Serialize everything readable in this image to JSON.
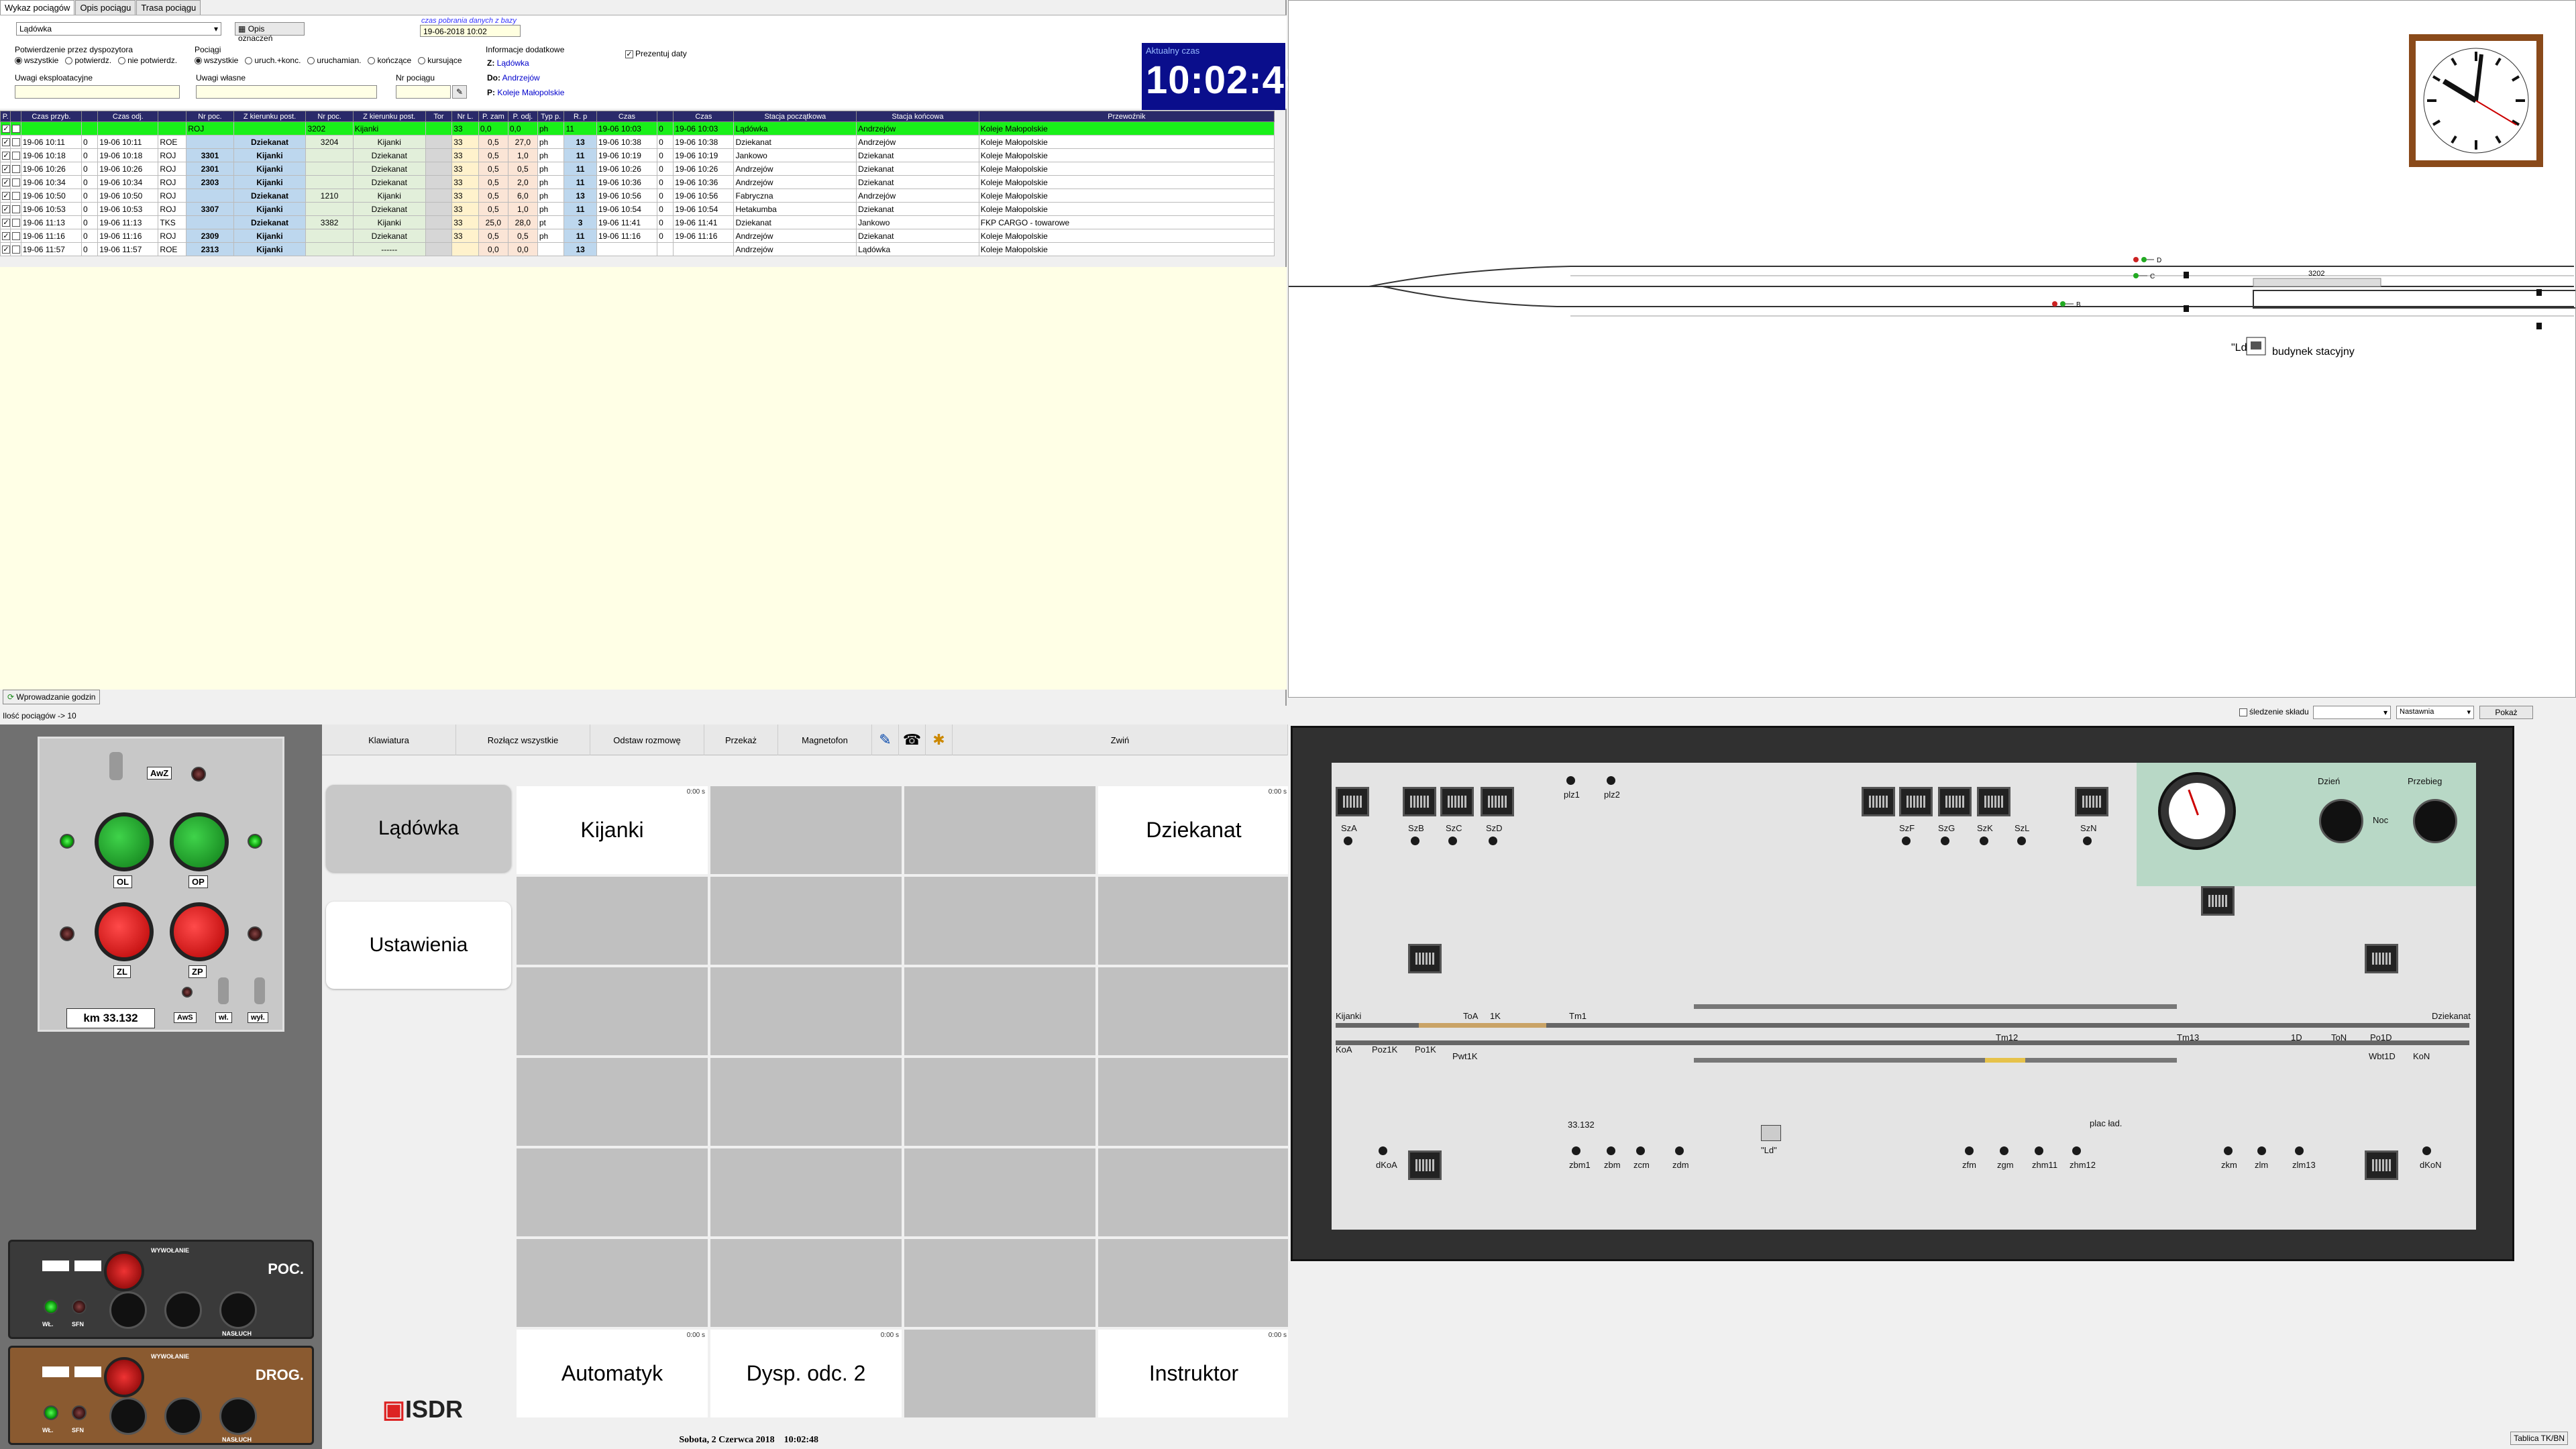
{
  "tabs": [
    "Wykaz pociągów",
    "Opis pociągu",
    "Trasa pociągu"
  ],
  "station_select": "Lądówka",
  "opis_button": "Opis oznaczeń",
  "db_time_label": "czas pobrania danych z bazy",
  "db_time_value": "19-06-2018 10:02",
  "filters": {
    "confirm_label": "Potwierdzenie przez dyspozytora",
    "confirm_opts": [
      "wszystkie",
      "potwierdz.",
      "nie potwierdz."
    ],
    "trains_label": "Pociągi",
    "trains_opts": [
      "wszystkie",
      "uruch.+konc.",
      "uruchamian.",
      "kończące",
      "kursujące"
    ],
    "info_label": "Informacje dodatkowe",
    "z_label": "Z:",
    "z_val": "Lądówka",
    "do_label": "Do:",
    "do_val": "Andrzejów",
    "p_label": "P:",
    "p_val": "Koleje Małopolskie",
    "uwagi_ekspl": "Uwagi eksploatacyjne",
    "uwagi_wlasne": "Uwagi własne",
    "nr_pociagu": "Nr pociągu",
    "prezentuj": "Prezentuj daty"
  },
  "current_time_label": "Aktualny czas",
  "current_time": "10:02:48",
  "table": {
    "headers": [
      "P.",
      "",
      "Czas przyb.",
      "",
      "Czas odj.",
      "",
      "Nr poc.",
      "Z kierunku post.",
      "Nr poc.",
      "Z kierunku post.",
      "Tor",
      "Nr L.",
      "P. zam",
      "P. odj.",
      "Typ p.",
      "R. p",
      "Czas",
      "",
      "Czas",
      "Stacja początkowa",
      "Stacja końcowa",
      "Przewoźnik"
    ],
    "rows": [
      [
        "",
        "",
        "",
        "",
        "ROJ",
        "",
        "3202",
        "Kijanki",
        "",
        "33",
        "0,0",
        "0,0",
        "ph",
        "11",
        "19-06 10:03",
        "0",
        "19-06 10:03",
        "Lądówka",
        "Andrzejów",
        "Koleje Małopolskie"
      ],
      [
        "19-06 10:11",
        "0",
        "19-06 10:11",
        "ROE",
        "",
        "Dziekanat",
        "3204",
        "Kijanki",
        "",
        "33",
        "0,5",
        "27,0",
        "ph",
        "13",
        "19-06 10:38",
        "0",
        "19-06 10:38",
        "Dziekanat",
        "Andrzejów",
        "Koleje Małopolskie"
      ],
      [
        "19-06 10:18",
        "0",
        "19-06 10:18",
        "ROJ",
        "3301",
        "Kijanki",
        "",
        "Dziekanat",
        "",
        "33",
        "0,5",
        "1,0",
        "ph",
        "11",
        "19-06 10:19",
        "0",
        "19-06 10:19",
        "Jankowo",
        "Dziekanat",
        "Koleje Małopolskie"
      ],
      [
        "19-06 10:26",
        "0",
        "19-06 10:26",
        "ROJ",
        "2301",
        "Kijanki",
        "",
        "Dziekanat",
        "",
        "33",
        "0,5",
        "0,5",
        "ph",
        "11",
        "19-06 10:26",
        "0",
        "19-06 10:26",
        "Andrzejów",
        "Dziekanat",
        "Koleje Małopolskie"
      ],
      [
        "19-06 10:34",
        "0",
        "19-06 10:34",
        "ROJ",
        "2303",
        "Kijanki",
        "",
        "Dziekanat",
        "",
        "33",
        "0,5",
        "2,0",
        "ph",
        "11",
        "19-06 10:36",
        "0",
        "19-06 10:36",
        "Andrzejów",
        "Dziekanat",
        "Koleje Małopolskie"
      ],
      [
        "19-06 10:50",
        "0",
        "19-06 10:50",
        "ROJ",
        "",
        "Dziekanat",
        "1210",
        "Kijanki",
        "",
        "33",
        "0,5",
        "6,0",
        "ph",
        "13",
        "19-06 10:56",
        "0",
        "19-06 10:56",
        "Fabryczna",
        "Andrzejów",
        "Koleje Małopolskie"
      ],
      [
        "19-06 10:53",
        "0",
        "19-06 10:53",
        "ROJ",
        "3307",
        "Kijanki",
        "",
        "Dziekanat",
        "",
        "33",
        "0,5",
        "1,0",
        "ph",
        "11",
        "19-06 10:54",
        "0",
        "19-06 10:54",
        "Hetakumba",
        "Dziekanat",
        "Koleje Małopolskie"
      ],
      [
        "19-06 11:13",
        "0",
        "19-06 11:13",
        "TKS",
        "",
        "Dziekanat",
        "3382",
        "Kijanki",
        "",
        "33",
        "25,0",
        "28,0",
        "pt",
        "3",
        "19-06 11:41",
        "0",
        "19-06 11:41",
        "Dziekanat",
        "Jankowo",
        "FKP CARGO - towarowe"
      ],
      [
        "19-06 11:16",
        "0",
        "19-06 11:16",
        "ROJ",
        "2309",
        "Kijanki",
        "",
        "Dziekanat",
        "",
        "33",
        "0,5",
        "0,5",
        "ph",
        "11",
        "19-06 11:16",
        "0",
        "19-06 11:16",
        "Andrzejów",
        "Dziekanat",
        "Koleje Małopolskie"
      ],
      [
        "19-06 11:57",
        "0",
        "19-06 11:57",
        "ROE",
        "2313",
        "Kijanki",
        "",
        "------",
        "",
        "",
        "0,0",
        "0,0",
        "",
        "13",
        "",
        "",
        "",
        "Andrzejów",
        "Lądówka",
        "Koleje Małopolskie"
      ]
    ]
  },
  "wprowadzanie": "Wprowadzanie godzin",
  "status_count": "Ilość pociągów -> 10",
  "schema": {
    "track_3202": "3202",
    "ld_label": "\"Ld\"",
    "building": "budynek stacyjny",
    "sig_d": "D",
    "sig_c": "C",
    "sig_b": "B"
  },
  "right_top_bar": {
    "sledzenie": "śledzenie składu",
    "nastawnia": "Nastawnia",
    "pokaz": "Pokaż"
  },
  "console": {
    "awz": "AwZ",
    "ol": "OL",
    "op": "OP",
    "zl": "ZL",
    "zp": "ZP",
    "km": "km 33.132",
    "aws": "AwS",
    "wl": "wł.",
    "wyl": "wył.",
    "poc": "POC.",
    "drog": "DROG.",
    "wywolanie": "WYWOŁANIE",
    "nasluch": "NASŁUCH",
    "wl_short": "WŁ.",
    "sfn": "SFN"
  },
  "toolbar": [
    "Klawiatura",
    "Rozłącz wszystkie",
    "Odstaw rozmowę",
    "Przekaż",
    "Magnetofon",
    "Zwiń"
  ],
  "dispatcher": {
    "side": [
      "Lądówka",
      "Ustawienia"
    ],
    "cells": {
      "kijanki": "Kijanki",
      "dziekanat": "Dziekanat",
      "automatyk": "Automatyk",
      "dysp": "Dysp. odc. 2",
      "instruktor": "Instruktor",
      "timer": "0:00 s"
    },
    "brand": "ISDR",
    "status_date": "Sobota, 2 Czerwca 2018",
    "status_time": "10:02:48"
  },
  "board": {
    "dzien": "Dzień",
    "noc": "Noc",
    "przeb": "Przebieg",
    "labels_top": [
      "SzA",
      "SzB",
      "SzC",
      "SzD",
      "plz1",
      "plz2",
      "SzF",
      "SzG",
      "SzK",
      "SzL",
      "SzN"
    ],
    "row_labels": [
      "Kijanki",
      "ToA",
      "1K",
      "Tm1",
      "Dziekanat",
      "KoA",
      "Poz1K",
      "Po1K",
      "Pwt1K",
      "Tm12",
      "Tm13",
      "1D",
      "ToN",
      "Po1D",
      "KoN",
      "Wbt1D"
    ],
    "bottom_labels": [
      "dKoA",
      "zbm1",
      "zbm",
      "zcm",
      "zdm",
      "zfm",
      "zgm",
      "zhm11",
      "zhm12",
      "zkm",
      "zlm",
      "zlm13",
      "dKoN"
    ],
    "ld": "\"Ld\"",
    "km": "33.132",
    "plac": "plac ład.",
    "tablica": "Tablica TK/BN"
  }
}
